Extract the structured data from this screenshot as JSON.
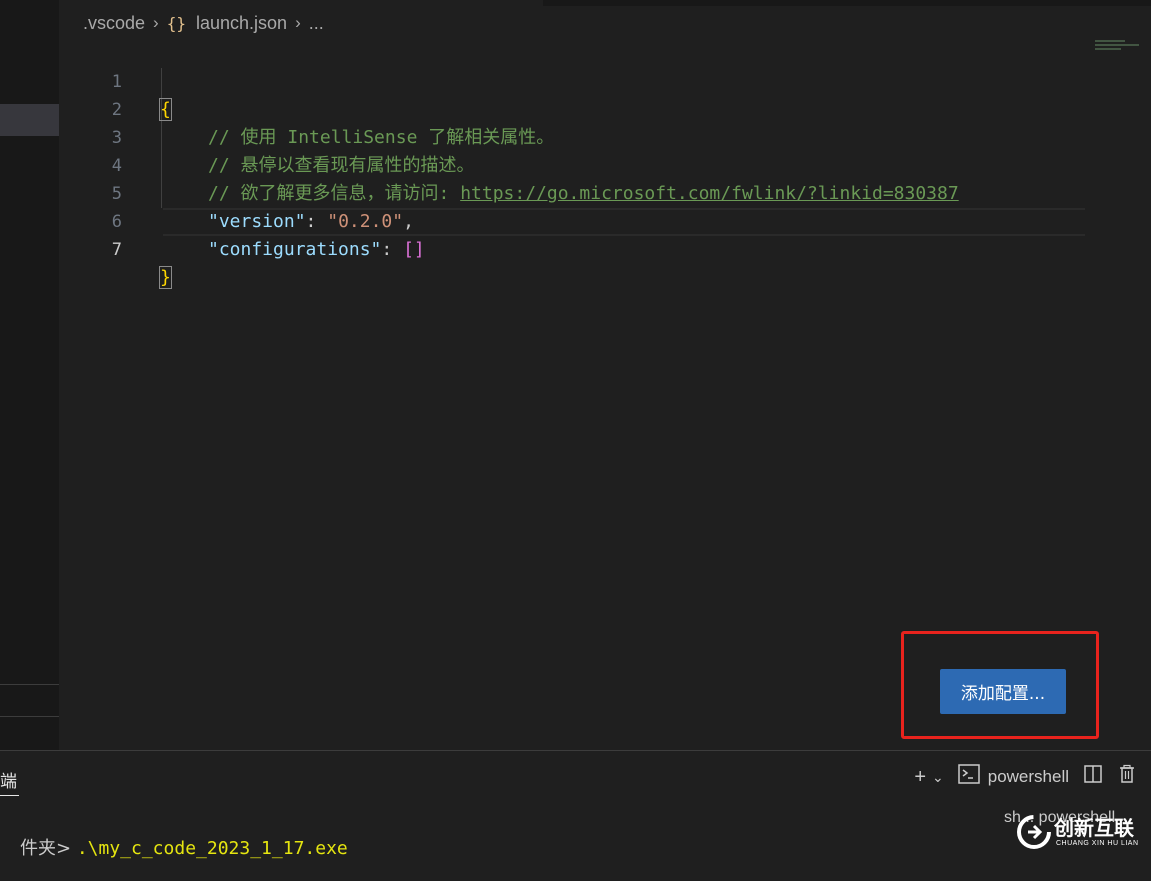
{
  "breadcrumb": {
    "folder": ".vscode",
    "brace": "{}",
    "file": "launch.json",
    "more": "..."
  },
  "editor": {
    "lines": [
      {
        "num": "1",
        "open_brace": "{"
      },
      {
        "num": "2",
        "comment_prefix": "// 使用 ",
        "comment_word": "IntelliSense",
        "comment_rest": " 了解相关属性。"
      },
      {
        "num": "3",
        "comment": "// 悬停以查看现有属性的描述。"
      },
      {
        "num": "4",
        "comment": "// 欲了解更多信息，请访问: ",
        "link": "https://go.microsoft.com/fwlink/?linkid=830387"
      },
      {
        "num": "5",
        "key": "\"version\"",
        "colon": ": ",
        "value": "\"0.2.0\"",
        "comma": ","
      },
      {
        "num": "6",
        "key": "\"configurations\"",
        "colon": ": ",
        "value": "[]"
      },
      {
        "num": "7",
        "close_brace": "}"
      }
    ]
  },
  "add_config_button": {
    "label": "添加配置..."
  },
  "panel": {
    "tab_label": "端",
    "new_terminal_icon": "plus-icon",
    "terminal_name": "powershell",
    "terminal_list_label": "sh... powershell",
    "prompt": "件夹> ",
    "command": ".\\my_c_code_2023_1_17.exe"
  },
  "watermark": {
    "name": "创新互联",
    "sub": "CHUANG XIN HU LIAN"
  },
  "colors": {
    "button": "#2d6ab3",
    "highlight_box": "#e8231d",
    "background": "#1f1f1f"
  }
}
